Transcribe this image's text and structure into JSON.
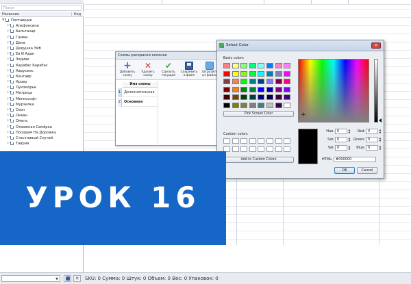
{
  "left_panel": {
    "search_placeholder": "Поиск",
    "columns": {
      "name": "Название",
      "code": "Код"
    },
    "root_item": "Поставщик",
    "items": [
      "Алефонсина",
      "Бальтазар",
      "Гамми",
      "Дана",
      "Дедушка Эйб",
      "Ев И Адан",
      "Зодиак",
      "Карабас Барабас",
      "Карусель",
      "Кентавр",
      "Крово",
      "Лукоморье",
      "Матрица",
      "Мелкософт",
      "Мурзилка",
      "Озон",
      "Океан",
      "Омега",
      "Отважная Семёрка",
      "Посидим На Дорожку",
      "Счастливый Случай",
      "Таврия"
    ]
  },
  "schemes_window": {
    "title": "Схемы раскраски колонок",
    "toolbar": [
      {
        "label": "Добавить\nсхему",
        "icon": "plus-icon"
      },
      {
        "label": "Удалить\nсхему",
        "icon": "delete-icon"
      },
      {
        "label": "Сделать\nтекущей",
        "icon": "check-icon"
      },
      {
        "label": "Сохранить\nв файл",
        "icon": "save-icon"
      },
      {
        "label": "Загрузить\nиз файла",
        "icon": "load-icon"
      }
    ],
    "column_header": "Имя схемы",
    "rows": [
      {
        "num": "1",
        "name": "Дополнительная"
      },
      {
        "num": "2",
        "name": "Основная"
      }
    ]
  },
  "color_dialog": {
    "title": "Select Color",
    "basic_colors_label": "Basic colors",
    "pick_screen_label": "Pick Screen Color",
    "custom_colors_label": "Custom colors",
    "add_custom_label": "Add to Custom Colors",
    "swatches": [
      "#ff8080",
      "#ffff80",
      "#80ff80",
      "#00ff80",
      "#80ffff",
      "#0080ff",
      "#ff80c0",
      "#ff80ff",
      "#ff0000",
      "#ffff00",
      "#80ff00",
      "#00ff40",
      "#00ffff",
      "#0080c0",
      "#8080c0",
      "#ff00ff",
      "#804040",
      "#ff8040",
      "#00ff00",
      "#008080",
      "#004080",
      "#8080ff",
      "#800040",
      "#ff0080",
      "#800000",
      "#ff8000",
      "#008000",
      "#008040",
      "#0000ff",
      "#0000a0",
      "#800080",
      "#8000ff",
      "#400000",
      "#804000",
      "#004000",
      "#004040",
      "#000080",
      "#000040",
      "#400040",
      "#400080",
      "#000000",
      "#808000",
      "#808040",
      "#808080",
      "#408080",
      "#c0c0c0",
      "#400040",
      "#ffffff"
    ],
    "fields": {
      "hue_label": "Hue:",
      "hue": "0",
      "sat_label": "Sat:",
      "sat": "0",
      "val_label": "Val:",
      "val": "0",
      "red_label": "Red:",
      "red": "0",
      "green_label": "Green:",
      "green": "0",
      "blue_label": "Blue:",
      "blue": "0"
    },
    "html_label": "HTML:",
    "html_value": "#000000",
    "ok_label": "OK",
    "cancel_label": "Cancel",
    "current_color": "#000000"
  },
  "banner": {
    "text": "УРОК 16",
    "color": "#1566c6"
  },
  "status_bar": {
    "summary": "SKU: 0  Сумма: 0  Штук: 0  Объем: 0  Вес: 0  Упаковок: 0"
  }
}
